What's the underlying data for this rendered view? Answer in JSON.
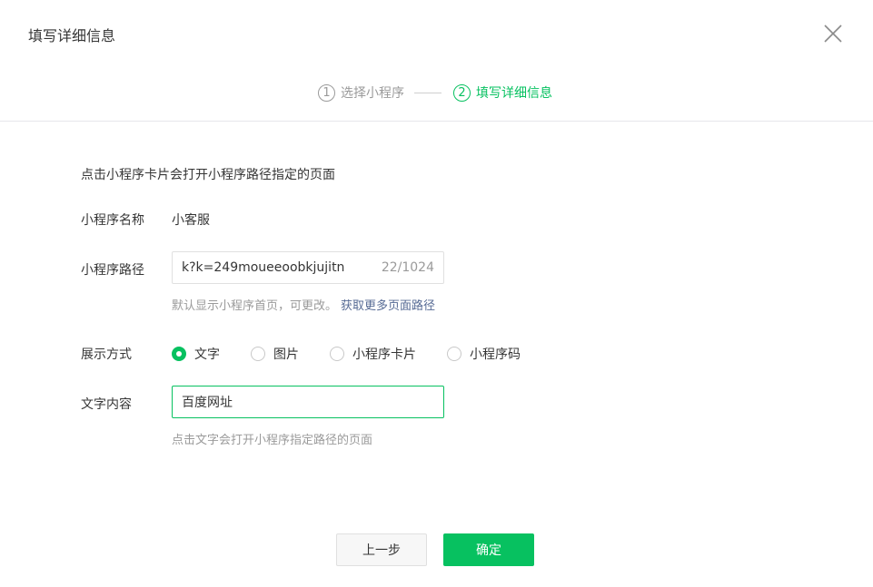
{
  "dialog": {
    "title": "填写详细信息",
    "close_icon": "close-icon"
  },
  "steps": [
    {
      "num": "1",
      "label": "选择小程序",
      "active": false
    },
    {
      "num": "2",
      "label": "填写详细信息",
      "active": true
    }
  ],
  "intro": "点击小程序卡片会打开小程序路径指定的页面",
  "form": {
    "name_label": "小程序名称",
    "name_value": "小客服",
    "path_label": "小程序路径",
    "path_value": "k?k=249moueeoobkjujitn",
    "path_counter": "22/1024",
    "path_tip": "默认显示小程序首页，可更改。",
    "path_link": "获取更多页面路径",
    "display_label": "展示方式",
    "display_options": [
      {
        "label": "文字",
        "checked": true
      },
      {
        "label": "图片",
        "checked": false
      },
      {
        "label": "小程序卡片",
        "checked": false
      },
      {
        "label": "小程序码",
        "checked": false
      }
    ],
    "text_label": "文字内容",
    "text_value": "百度网址",
    "text_tip": "点击文字会打开小程序指定路径的页面"
  },
  "footer": {
    "prev_label": "上一步",
    "confirm_label": "确定"
  },
  "colors": {
    "primary": "#07c160",
    "link": "#576b95",
    "muted": "#9a9a9a"
  }
}
